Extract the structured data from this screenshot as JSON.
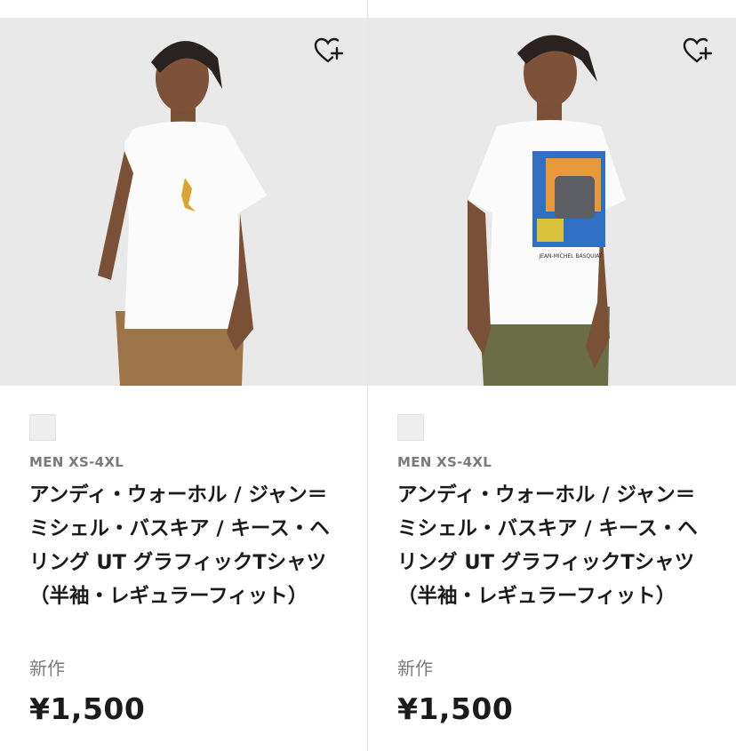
{
  "colors": {
    "image_bg": "#e9e9ea",
    "text": "#1b1b1b",
    "muted": "#7a7a7a"
  },
  "products": [
    {
      "gender_size": "MEN XS-4XL",
      "name": "アンディ・ウォーホル / ジャン＝ミシェル・バスキア / キース・ヘリング UT グラフィックTシャツ（半袖・レギュラーフィット）",
      "tag": "新作",
      "price": "¥1,500",
      "favorite_icon": "heart-plus-icon",
      "print_text": ""
    },
    {
      "gender_size": "MEN XS-4XL",
      "name": "アンディ・ウォーホル / ジャン＝ミシェル・バスキア / キース・ヘリング UT グラフィックTシャツ（半袖・レギュラーフィット）",
      "tag": "新作",
      "price": "¥1,500",
      "favorite_icon": "heart-plus-icon",
      "print_text": "JEAN-MICHEL BASQUIAT"
    }
  ]
}
